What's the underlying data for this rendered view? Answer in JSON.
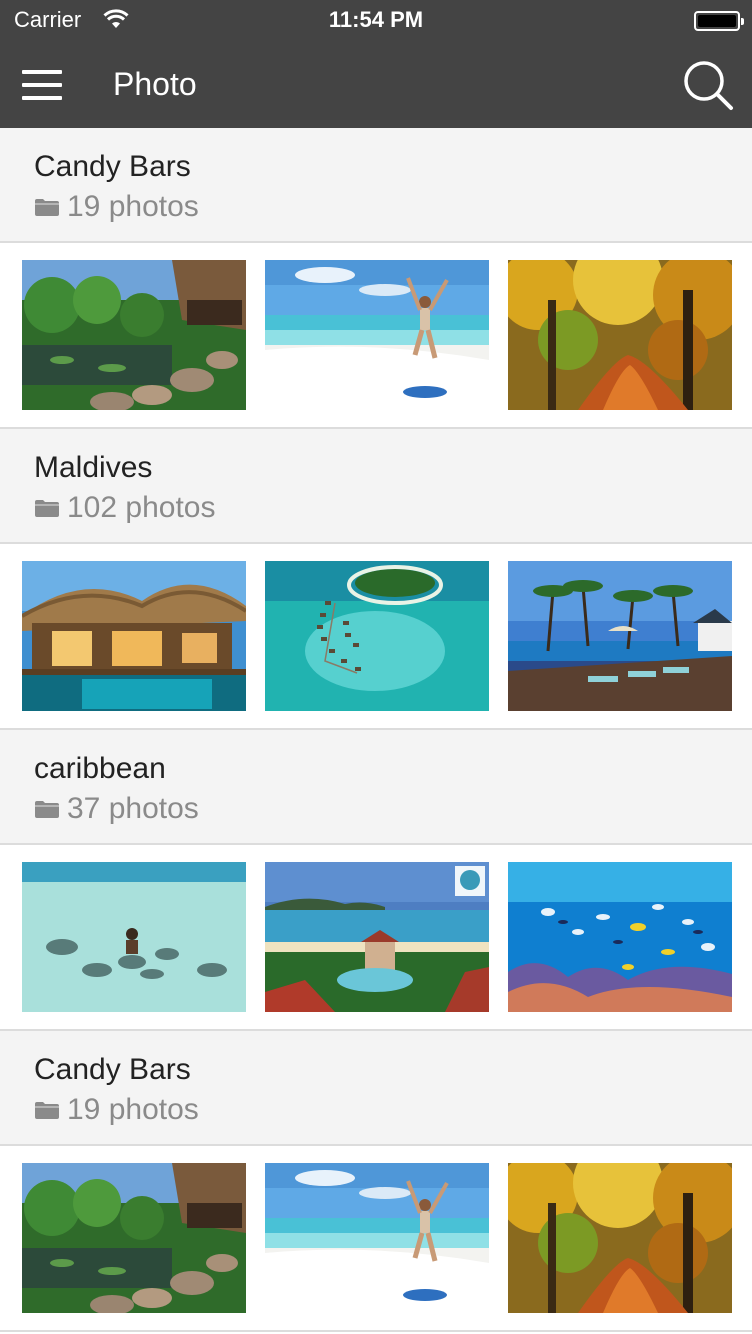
{
  "status_bar": {
    "carrier": "Carrier",
    "time": "11:54 PM"
  },
  "nav": {
    "title": "Photo",
    "menu_icon": "hamburger-menu-icon",
    "search_icon": "search-icon"
  },
  "colors": {
    "nav_background": "#444444",
    "section_background": "#f4f4f4",
    "count_text": "#8a8a8a"
  },
  "albums": [
    {
      "title": "Candy Bars",
      "count": "19 photos",
      "photos": [
        "garden-pond",
        "beach-jump",
        "autumn-forest"
      ]
    },
    {
      "title": "Maldives",
      "count": "102 photos",
      "photos": [
        "overwater-villa",
        "atoll-aerial",
        "poolside-palms"
      ]
    },
    {
      "title": "caribbean",
      "count": "37 photos",
      "photos": [
        "stingray-lagoon",
        "resort-bay",
        "coral-reef-fish"
      ]
    },
    {
      "title": "Candy Bars",
      "count": "19 photos",
      "photos": [
        "garden-pond",
        "beach-jump",
        "autumn-forest"
      ]
    }
  ]
}
